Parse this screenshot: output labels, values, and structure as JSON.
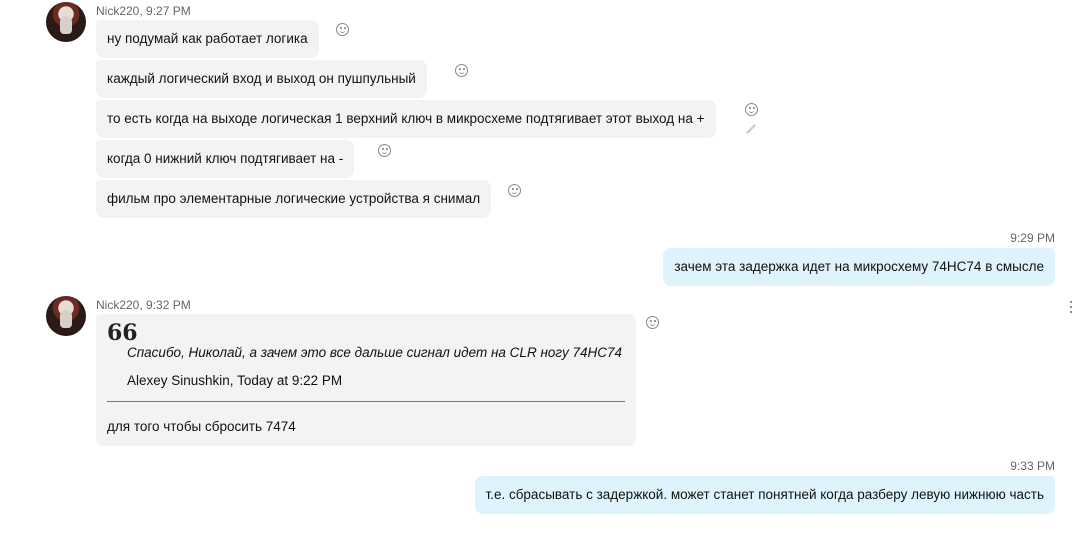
{
  "messages": {
    "group1": {
      "sender": "Nick220, 9:27 PM",
      "lines": [
        "ну подумай как работает логика",
        "каждый логический вход и выход он  пушпульный",
        "то есть когда на выходе логическая 1 верхний ключ в микросхеме подтягивает этот выход на +",
        "когда 0 нижний ключ подтягивает на -",
        "фильм про элементарные логические устройства я снимал"
      ]
    },
    "outgoing1": {
      "time": "9:29 PM",
      "text": "зачем эта задержка идет на микросхему 74HC74 в смысле"
    },
    "group2": {
      "sender": "Nick220, 9:32 PM",
      "quote_mark": "66",
      "quote_text": "Спасибо, Николай, а зачем это все дальше сигнал идет на CLR ногу 74HC74",
      "quote_author": "Alexey Sinushkin, Today at 9:22 PM",
      "reply": "для того чтобы сбросить 7474"
    },
    "outgoing2": {
      "time": "9:33 PM",
      "text": "т.е. сбрасывать с задержкой. может станет понятней когда разберу левую нижнюю часть"
    }
  },
  "icons": {
    "reaction": "smiley-icon",
    "edit": "pencil-icon",
    "more": "more-vertical-icon"
  },
  "colors": {
    "incoming_bubble": "#f1f3f5",
    "outgoing_bubble": "#dff3fc",
    "meta_text": "#666666"
  }
}
